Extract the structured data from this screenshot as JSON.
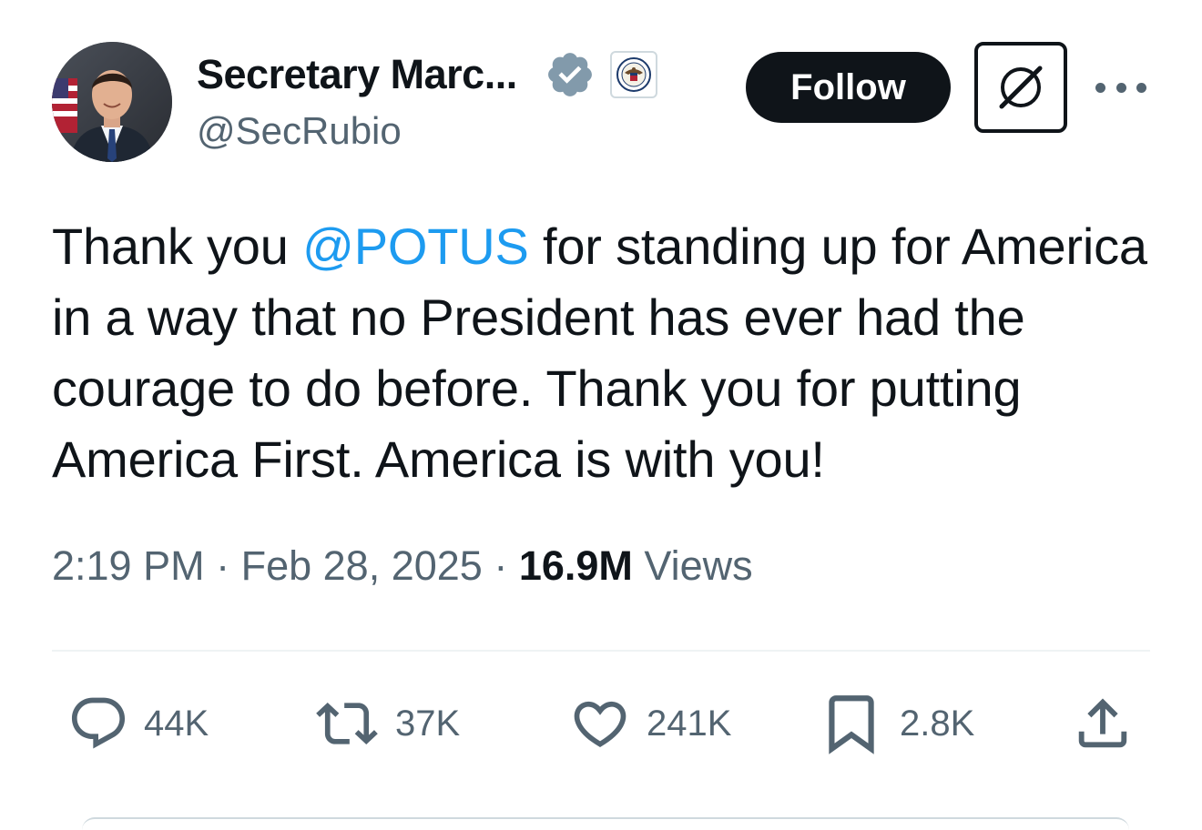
{
  "author": {
    "display_name": "Secretary Marc...",
    "handle": "@SecRubio",
    "verified_badge_icon": "verified-badge-icon",
    "affiliate_badge_icon": "state-department-seal-icon",
    "verified_color": "#829aab"
  },
  "header": {
    "follow_label": "Follow",
    "grok_icon": "grok-icon",
    "more_icon": "more-dots-icon"
  },
  "tweet": {
    "text_before": "Thank you ",
    "mention": "@POTUS",
    "text_after": " for standing up for America in a way that no President has ever had the courage to do before. Thank you for putting America First. America is with you!"
  },
  "meta": {
    "time": "2:19 PM",
    "separator": " · ",
    "date": "Feb 28, 2025",
    "views_count": "16.9M",
    "views_label": " Views"
  },
  "actions": {
    "replies": "44K",
    "reposts": "37K",
    "likes": "241K",
    "bookmarks": "2.8K"
  },
  "colors": {
    "text_primary": "#0f1419",
    "text_secondary": "#536471",
    "link": "#1d9bf0",
    "divider": "#eff3f4"
  }
}
